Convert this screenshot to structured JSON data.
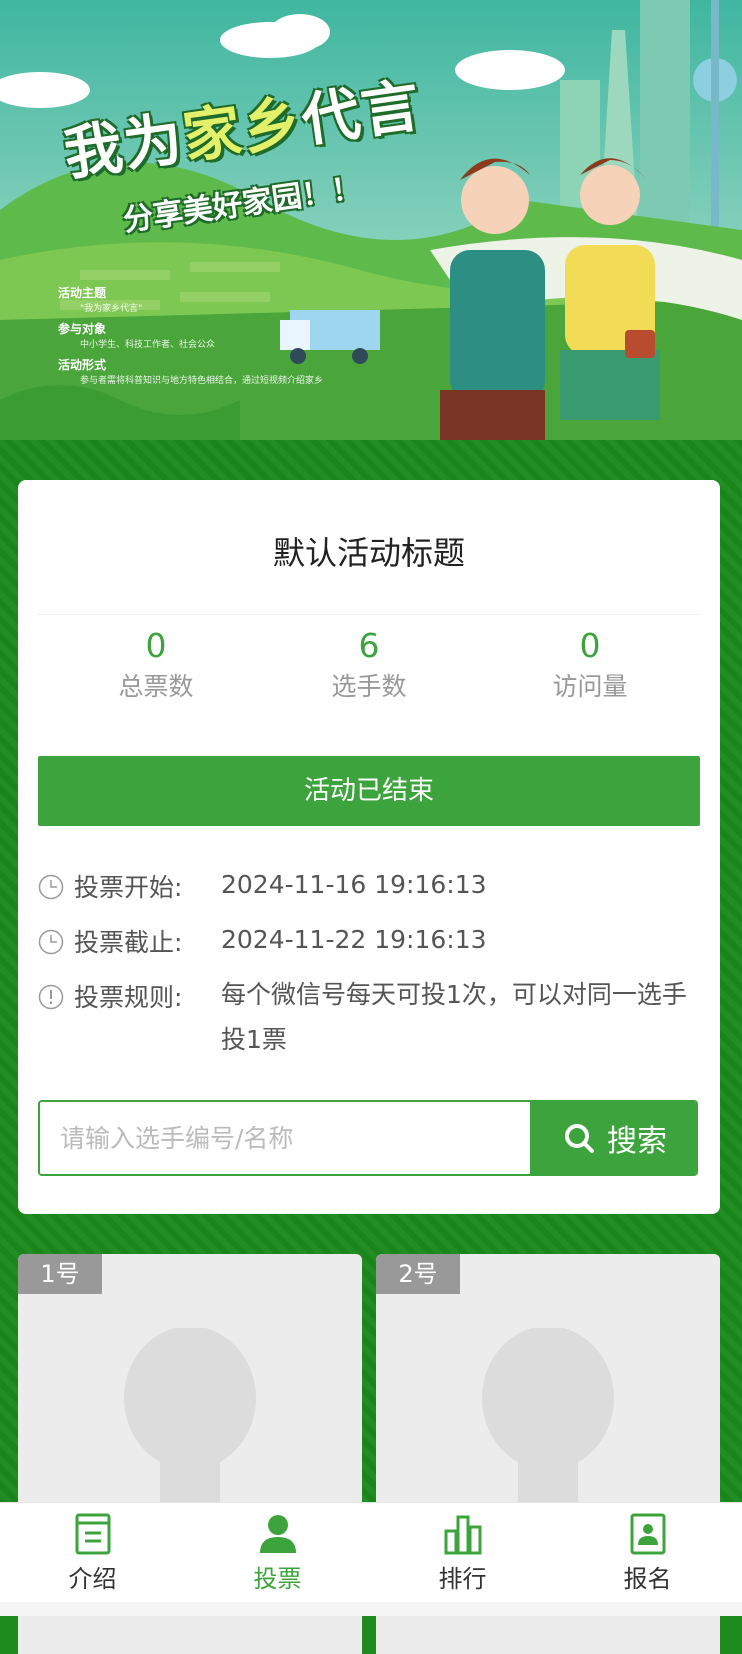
{
  "banner": {
    "title_part1": "我为",
    "title_highlight": "家乡",
    "title_part2": "代言",
    "subtitle": "分享美好家园！！",
    "info": [
      {
        "label": "活动主题",
        "text": "\"我为家乡代言\""
      },
      {
        "label": "参与对象",
        "text": "中小学生、科技工作者、社会公众"
      },
      {
        "label": "活动形式",
        "text": "参与者需将科普知识与地方特色相结合，通过短视频介绍家乡"
      }
    ]
  },
  "activity": {
    "title": "默认活动标题",
    "stats": [
      {
        "value": "0",
        "label": "总票数"
      },
      {
        "value": "6",
        "label": "选手数"
      },
      {
        "value": "0",
        "label": "访问量"
      }
    ],
    "status_label": "活动已结束",
    "vote_start_label": "投票开始:",
    "vote_start_value": "2024-11-16 19:16:13",
    "vote_end_label": "投票截止:",
    "vote_end_value": "2024-11-22 19:16:13",
    "rules_label": "投票规则:",
    "rules_value": "每个微信号每天可投1次，可以对同一选手投1票"
  },
  "search": {
    "placeholder": "请输入选手编号/名称",
    "button_label": "搜索"
  },
  "contestants": [
    {
      "badge": "1号"
    },
    {
      "badge": "2号"
    }
  ],
  "tabbar": {
    "items": [
      {
        "label": "介绍",
        "icon": "document-icon"
      },
      {
        "label": "投票",
        "icon": "person-icon"
      },
      {
        "label": "排行",
        "icon": "bar-chart-icon"
      },
      {
        "label": "报名",
        "icon": "id-card-icon"
      }
    ],
    "active_index": 1
  },
  "colors": {
    "accent": "#3da43d",
    "page_background": "#1b891b"
  }
}
